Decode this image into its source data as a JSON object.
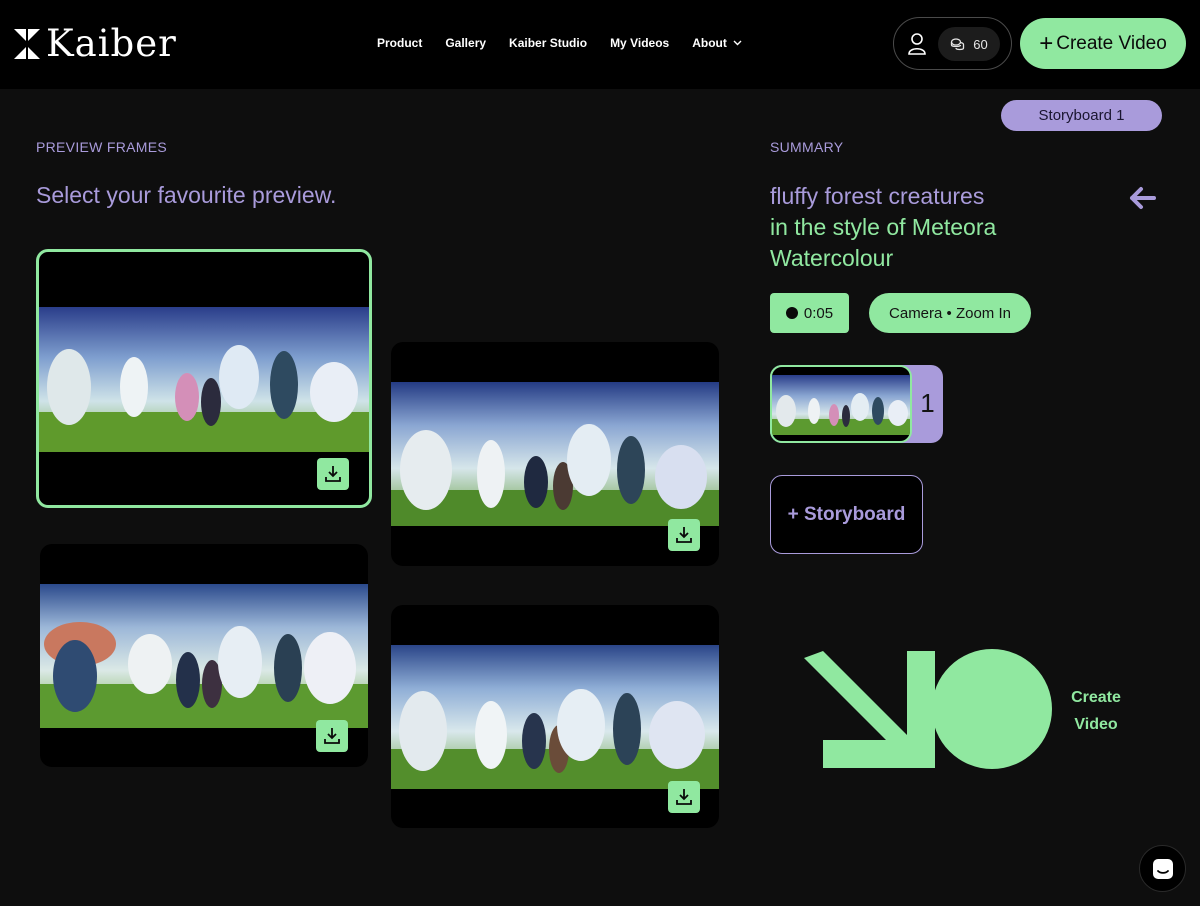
{
  "brand": {
    "name": "Kaiber"
  },
  "nav": {
    "items": [
      {
        "label": "Product"
      },
      {
        "label": "Gallery"
      },
      {
        "label": "Kaiber Studio"
      },
      {
        "label": "My Videos"
      },
      {
        "label": "About"
      }
    ]
  },
  "account": {
    "credits": "60"
  },
  "header_cta": {
    "plus": "+",
    "label": "Create Video"
  },
  "preview": {
    "section_label": "PREVIEW FRAMES",
    "instruction": "Select your favourite preview.",
    "frames": [
      {
        "selected": true
      },
      {
        "selected": false
      },
      {
        "selected": false
      },
      {
        "selected": false
      }
    ]
  },
  "summary": {
    "section_label": "SUMMARY",
    "storyboard_tab": "Storyboard 1",
    "subject": "fluffy forest creatures",
    "style": "in the style of Meteora Watercolour",
    "duration": "0:05",
    "camera": "Camera • Zoom In",
    "scene_number": "1",
    "add_storyboard": "+ Storyboard",
    "create_label": "Create Video"
  },
  "colors": {
    "accent_green": "#90e8a0",
    "accent_purple": "#a99bdb",
    "background": "#0e0e0e",
    "header": "#000000"
  },
  "icons": [
    "kaiber-logo-icon",
    "chevron-down-icon",
    "user-icon",
    "coins-icon",
    "download-icon",
    "back-arrow-icon",
    "record-dot-icon",
    "create-video-arrow-icon",
    "chat-icon"
  ]
}
